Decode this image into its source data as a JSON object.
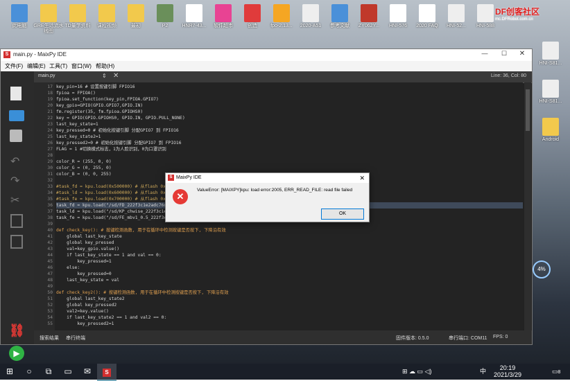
{
  "desktop": {
    "icons_row1": [
      "此电脑",
      "GRE生活流水线图",
      "TD量学资料",
      "课程视频",
      "最初",
      "P2",
      "HNR7-43...",
      "软件超市",
      "创造",
      "fpo-2.13...",
      "2020-A51",
      "参考文献",
      "ZY062Y...",
      "HNI-576",
      "2020 FAQ",
      "HNI-52...",
      "HNI-588"
    ],
    "icons_right": [
      "HNI-S81...",
      "HNI-S81...",
      "Android"
    ],
    "watermark": "DF创客社区",
    "watermark_sub": "mc.DFRobot.com.cn"
  },
  "window": {
    "title": "main.py - MaixPy IDE",
    "menus": [
      "文件(F)",
      "编辑(E)",
      "工具(T)",
      "窗口(W)",
      "帮助(H)"
    ],
    "file_tab": "main.py",
    "cursor_pos": "Line: 36, Col: 80",
    "status": {
      "left_tabs": [
        "搜索结果",
        "串行终端"
      ],
      "firmware": "固件版本: 0.5.0",
      "port": "串行端口: COM11",
      "fps": "FPS: 0"
    }
  },
  "code": {
    "lines": [
      {
        "n": "17",
        "t": "key_pin=16 # 设置按键引脚 FPIO16"
      },
      {
        "n": "18",
        "t": "fpioa = FPIOA()"
      },
      {
        "n": "19",
        "t": "fpioa.set_function(key_pin,FPIOA.GPIO7)"
      },
      {
        "n": "20",
        "t": "key_gpio=GPIO(GPIO.GPIO7,GPIO.IN)"
      },
      {
        "n": "21",
        "t": "fm.register(35, fm.fpioa.GPIOHS0)"
      },
      {
        "n": "22",
        "t": "key = GPIO(GPIO.GPIOHS0, GPIO.IN, GPIO.PULL_NONE)"
      },
      {
        "n": "23",
        "t": "last_key_state=1"
      },
      {
        "n": "24",
        "t": "key_pressed=0 # 初始化按键引脚 分配GPIO7 到 FPIO16"
      },
      {
        "n": "25",
        "t": "last_key_state2=1"
      },
      {
        "n": "26",
        "t": "key_pressed2=0 # 初始化按键引脚 分配GPIO7 到 FPIO16"
      },
      {
        "n": "27",
        "t": "FLAG = 1 #切换模式标志，1为人脸识别，0为口罩识别"
      },
      {
        "n": "28",
        "t": ""
      },
      {
        "n": "29",
        "t": "color_R = (255, 0, 0)"
      },
      {
        "n": "30",
        "t": "color_G = (0, 255, 0)"
      },
      {
        "n": "31",
        "t": "color_B = (0, 0, 255)"
      },
      {
        "n": "32",
        "t": ""
      },
      {
        "n": "33",
        "t": "#task_fd = kpu.load(0x500000) # 从flash 0x"
      },
      {
        "n": "34",
        "t": "#task_ld = kpu.load(0x600000) # 从flash 0x"
      },
      {
        "n": "35",
        "t": "#task_fe = kpu.load(0x700000) # 从flash 0x"
      },
      {
        "n": "36",
        "t": "task_fd = kpu.load(\"/sd/FD_222f3c1e2adc76d"
      },
      {
        "n": "37",
        "t": "task_ld = kpu.load(\"/sd/KP_chwise_222f3c1e"
      },
      {
        "n": "38",
        "t": "task_fe = kpu.load(\"/sd/FE_mbv1_0.5_222f3c"
      },
      {
        "n": "39",
        "t": ""
      },
      {
        "n": "40",
        "t": "def check_key(): # 按键检测函数, 用于在循环中检测按键是否按下, 下降沿有效"
      },
      {
        "n": "41",
        "t": "    global last_key_state"
      },
      {
        "n": "42",
        "t": "    global key_pressed"
      },
      {
        "n": "43",
        "t": "    val=key_gpio.value()"
      },
      {
        "n": "44",
        "t": "    if last_key_state == 1 and val == 0:"
      },
      {
        "n": "45",
        "t": "        key_pressed=1"
      },
      {
        "n": "46",
        "t": "    else:"
      },
      {
        "n": "47",
        "t": "        key_pressed=0"
      },
      {
        "n": "48",
        "t": "    last_key_state = val"
      },
      {
        "n": "49",
        "t": ""
      },
      {
        "n": "50",
        "t": "def check_key2(): # 按键检测函数, 用于在循环中检测按键是否按下, 下降沿有效"
      },
      {
        "n": "51",
        "t": "    global last_key_state2"
      },
      {
        "n": "52",
        "t": "    global key_pressed2"
      },
      {
        "n": "53",
        "t": "    val2=key.value()"
      },
      {
        "n": "54",
        "t": "    if last_key_state2 == 1 and val2 == 0:"
      },
      {
        "n": "55",
        "t": "        key_pressed2=1"
      }
    ],
    "highlight_line": "36"
  },
  "dialog": {
    "title": "MaixPy IDE",
    "message": "ValueError: [MAIXPY]kpu: load error:2005, ERR_READ_FILE: read file failed",
    "ok_label": "OK"
  },
  "taskbar": {
    "time": "20:19",
    "date": "2021/3/29",
    "ime": "中",
    "notif_count": "8"
  },
  "colors": {
    "error": "#e53935",
    "run": "#2fb344",
    "accent": "#0078d7"
  }
}
